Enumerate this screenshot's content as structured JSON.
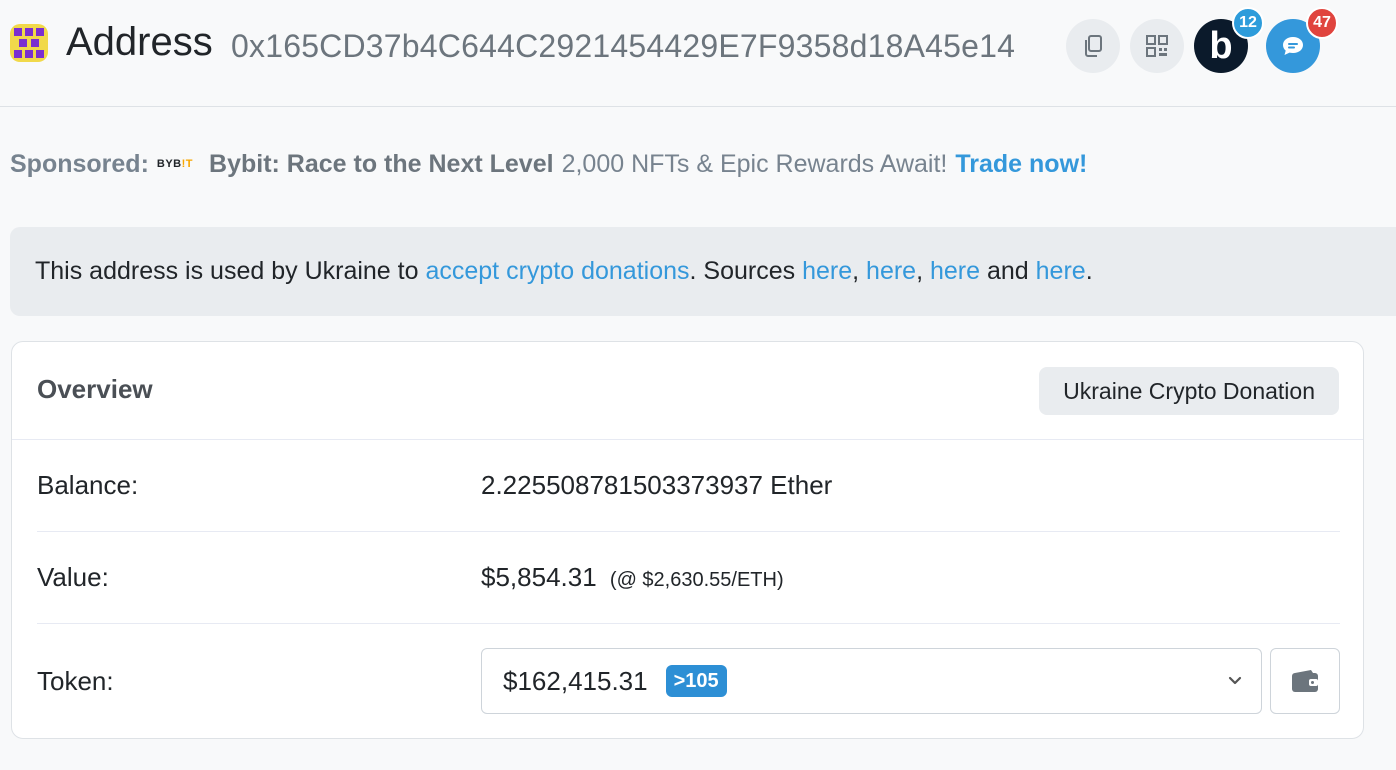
{
  "header": {
    "title_label": "Address",
    "address": "0x165CD37b4C644C2921454429E7F9358d18A45e14",
    "icons": {
      "copy": "copy-icon",
      "qr": "qr-code-icon",
      "extension_b": "b",
      "extension_b_count": "12",
      "chat_count": "47"
    }
  },
  "sponsored": {
    "label": "Sponsored:",
    "logo_text_a": "BYB",
    "logo_text_b": "!T",
    "title": "Bybit: Race to the Next Level",
    "text": "2,000 NFTs & Epic Rewards Await!",
    "cta": "Trade now!"
  },
  "alert": {
    "text_1": "This address is used by Ukraine to ",
    "link_1": "accept crypto donations",
    "text_2": ". Sources ",
    "link_2": "here",
    "sep_1": ", ",
    "link_3": "here",
    "sep_2": ", ",
    "link_4": "here",
    "text_3": " and ",
    "link_5": "here",
    "text_4": "."
  },
  "overview": {
    "title": "Overview",
    "tag": "Ukraine Crypto Donation",
    "balance_label": "Balance:",
    "balance_value": "2.225508781503373937 Ether",
    "value_label": "Value:",
    "value_amount": "$5,854.31",
    "value_rate": "(@ $2,630.55/ETH)",
    "token_label": "Token:",
    "token_amount": "$162,415.31",
    "token_count": ">105"
  },
  "colors": {
    "accent": "#3498db",
    "muted": "#77838f",
    "badge_red": "#e0443e"
  }
}
